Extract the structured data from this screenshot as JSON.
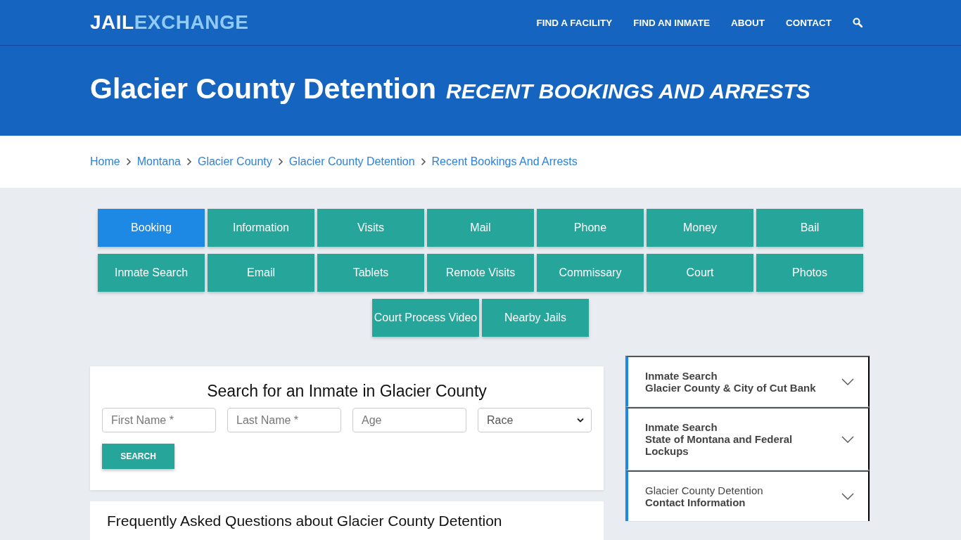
{
  "header": {
    "logo": {
      "part_1": "JAIL",
      "part_2": "EXCHANGE"
    },
    "nav": [
      "FIND A FACILITY",
      "FIND AN INMATE",
      "ABOUT",
      "CONTACT"
    ]
  },
  "hero": {
    "title": "Glacier County Detention",
    "subtitle": "RECENT BOOKINGS AND ARRESTS"
  },
  "breadcrumbs": [
    "Home",
    "Montana",
    "Glacier County",
    "Glacier County Detention",
    "Recent Bookings And Arrests"
  ],
  "tabs": [
    {
      "label": "Booking",
      "selected": true
    },
    {
      "label": "Information",
      "selected": false
    },
    {
      "label": "Visits",
      "selected": false
    },
    {
      "label": "Mail",
      "selected": false
    },
    {
      "label": "Phone",
      "selected": false
    },
    {
      "label": "Money",
      "selected": false
    },
    {
      "label": "Bail",
      "selected": false
    },
    {
      "label": "Inmate Search",
      "selected": false
    },
    {
      "label": "Email",
      "selected": false
    },
    {
      "label": "Tablets",
      "selected": false
    },
    {
      "label": "Remote Visits",
      "selected": false
    },
    {
      "label": "Commissary",
      "selected": false
    },
    {
      "label": "Court",
      "selected": false
    },
    {
      "label": "Photos",
      "selected": false
    },
    {
      "label": "Court Process Video",
      "selected": false
    },
    {
      "label": "Nearby Jails",
      "selected": false
    }
  ],
  "search_form": {
    "title": "Search for an Inmate in Glacier County",
    "fields": [
      {
        "kind": "input",
        "placeholder": "First Name *"
      },
      {
        "kind": "input",
        "placeholder": "Last Name *"
      },
      {
        "kind": "input",
        "placeholder": "Age"
      },
      {
        "kind": "select",
        "value": "Race"
      }
    ],
    "button": "SEARCH"
  },
  "faq": {
    "title": "Frequently Asked Questions about Glacier County Detention"
  },
  "sidebar": {
    "items": [
      {
        "kind": "bold-heading",
        "heading": "Inmate Search",
        "subheading": "Glacier County & City of Cut Bank",
        "expanded": false
      },
      {
        "kind": "bold-heading",
        "heading": "Inmate Search",
        "subheading": "State of Montana and Federal Lockups",
        "expanded": false
      },
      {
        "kind": "plain-heading",
        "heading": "Glacier County Detention",
        "subheading": "Contact Information",
        "expanded": false
      }
    ]
  }
}
